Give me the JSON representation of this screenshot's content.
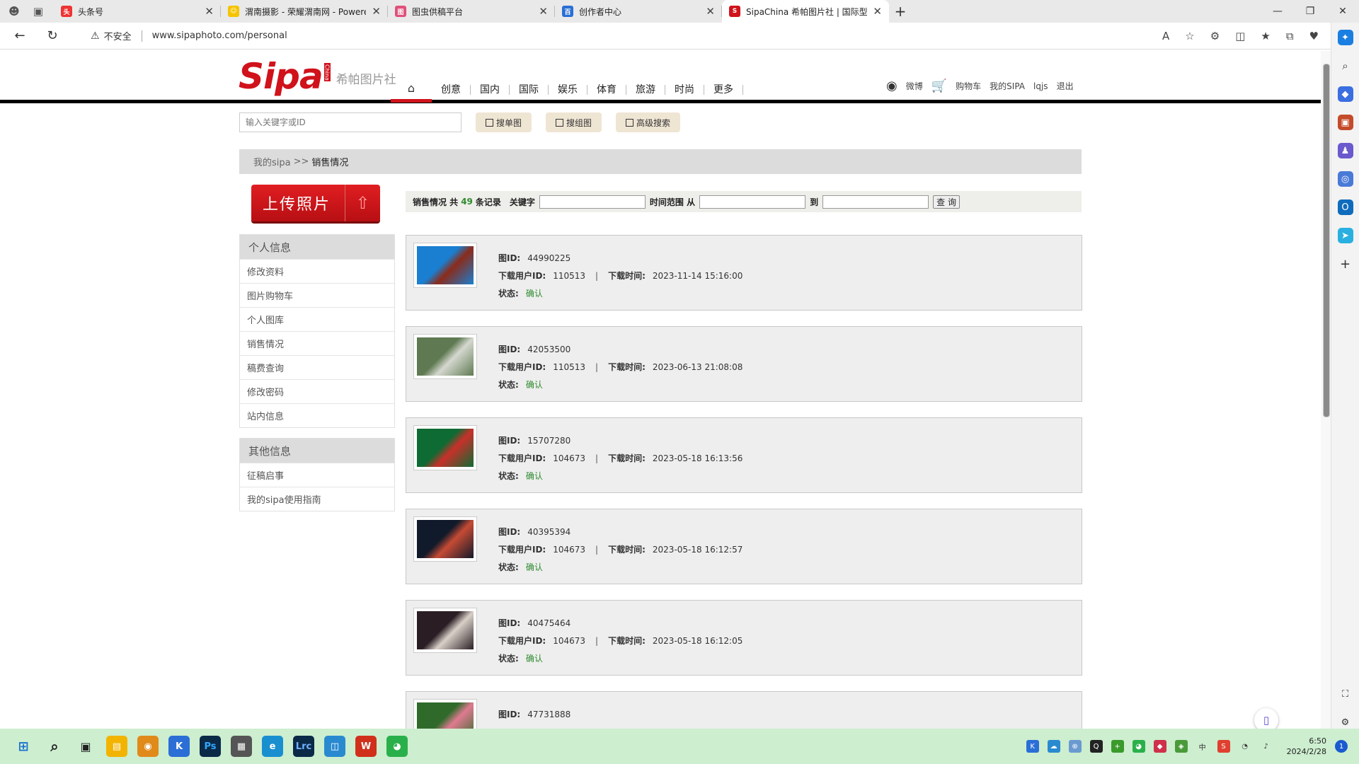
{
  "browser": {
    "tabs": [
      {
        "title": "头条号",
        "favicon": "toutiao-icon",
        "color": "#e33"
      },
      {
        "title": "渭南摄影 - 荣耀渭南网 - Powered",
        "favicon": "smiley-icon",
        "color": "#f5c400"
      },
      {
        "title": "图虫供稿平台",
        "favicon": "tuchong-icon",
        "color": "#e0507a"
      },
      {
        "title": "创作者中心",
        "favicon": "baijia-icon",
        "color": "#2a6fd6"
      },
      {
        "title": "SipaChina 希帕图片社 | 国际型综",
        "favicon": "sipa-icon",
        "color": "#d0121b",
        "active": true
      }
    ],
    "url_warning": "不安全",
    "url": "www.sipaphoto.com/personal"
  },
  "site": {
    "logo": "Sipa",
    "logo_badge": "China",
    "logo_sub": "希帕图片社",
    "nav": [
      "创意",
      "国内",
      "国际",
      "娱乐",
      "体育",
      "旅游",
      "时尚",
      "更多"
    ],
    "user_nav": {
      "weibo": "微博",
      "cart": "购物车",
      "my_sipa": "我的SIPA",
      "username": "lqjs",
      "logout": "退出"
    },
    "search_placeholder": "输入关键字或ID",
    "search_buttons": [
      "搜单图",
      "搜组图",
      "高级搜索"
    ]
  },
  "breadcrumb": {
    "parent": "我的sipa",
    "sep": ">>",
    "current": "销售情况"
  },
  "upload_label": "上传照片",
  "sidebar": {
    "group1_title": "个人信息",
    "group1_items": [
      "修改资料",
      "图片购物车",
      "个人图库",
      "销售情况",
      "稿费查询",
      "修改密码",
      "站内信息"
    ],
    "group2_title": "其他信息",
    "group2_items": [
      "征稿启事",
      "我的sipa使用指南"
    ]
  },
  "filter": {
    "label": "销售情况 共",
    "count": "49",
    "count_suffix": "条记录",
    "keyword_label": "关键字",
    "range_label": "时间范围 从",
    "to_label": "到",
    "query_button": "查 询"
  },
  "labels": {
    "image_id": "图ID:",
    "user_id": "下载用户ID:",
    "time": "下载时间:",
    "status": "状态:",
    "pipe": "|"
  },
  "records": [
    {
      "image_id": "44990225",
      "user_id": "110513",
      "time": "2023-11-14 15:16:00",
      "status": "确认",
      "thumb_colors": [
        "#1a7fd0",
        "#8b2b1a"
      ]
    },
    {
      "image_id": "42053500",
      "user_id": "110513",
      "time": "2023-06-13 21:08:08",
      "status": "确认",
      "thumb_colors": [
        "#5f7a52",
        "#d5d8cf"
      ]
    },
    {
      "image_id": "15707280",
      "user_id": "104673",
      "time": "2023-05-18 16:13:56",
      "status": "确认",
      "thumb_colors": [
        "#0e6b33",
        "#c8302a"
      ]
    },
    {
      "image_id": "40395394",
      "user_id": "104673",
      "time": "2023-05-18 16:12:57",
      "status": "确认",
      "thumb_colors": [
        "#111a2a",
        "#c64a34"
      ]
    },
    {
      "image_id": "40475464",
      "user_id": "104673",
      "time": "2023-05-18 16:12:05",
      "status": "确认",
      "thumb_colors": [
        "#2a1e24",
        "#d9d0c8"
      ]
    },
    {
      "image_id": "47731888",
      "user_id": "",
      "time": "",
      "status": "",
      "thumb_colors": [
        "#2f6a2a",
        "#e07a90"
      ]
    }
  ],
  "taskbar": {
    "clock_time": "6:50",
    "clock_date": "2024/2/28",
    "notification_count": "1"
  }
}
